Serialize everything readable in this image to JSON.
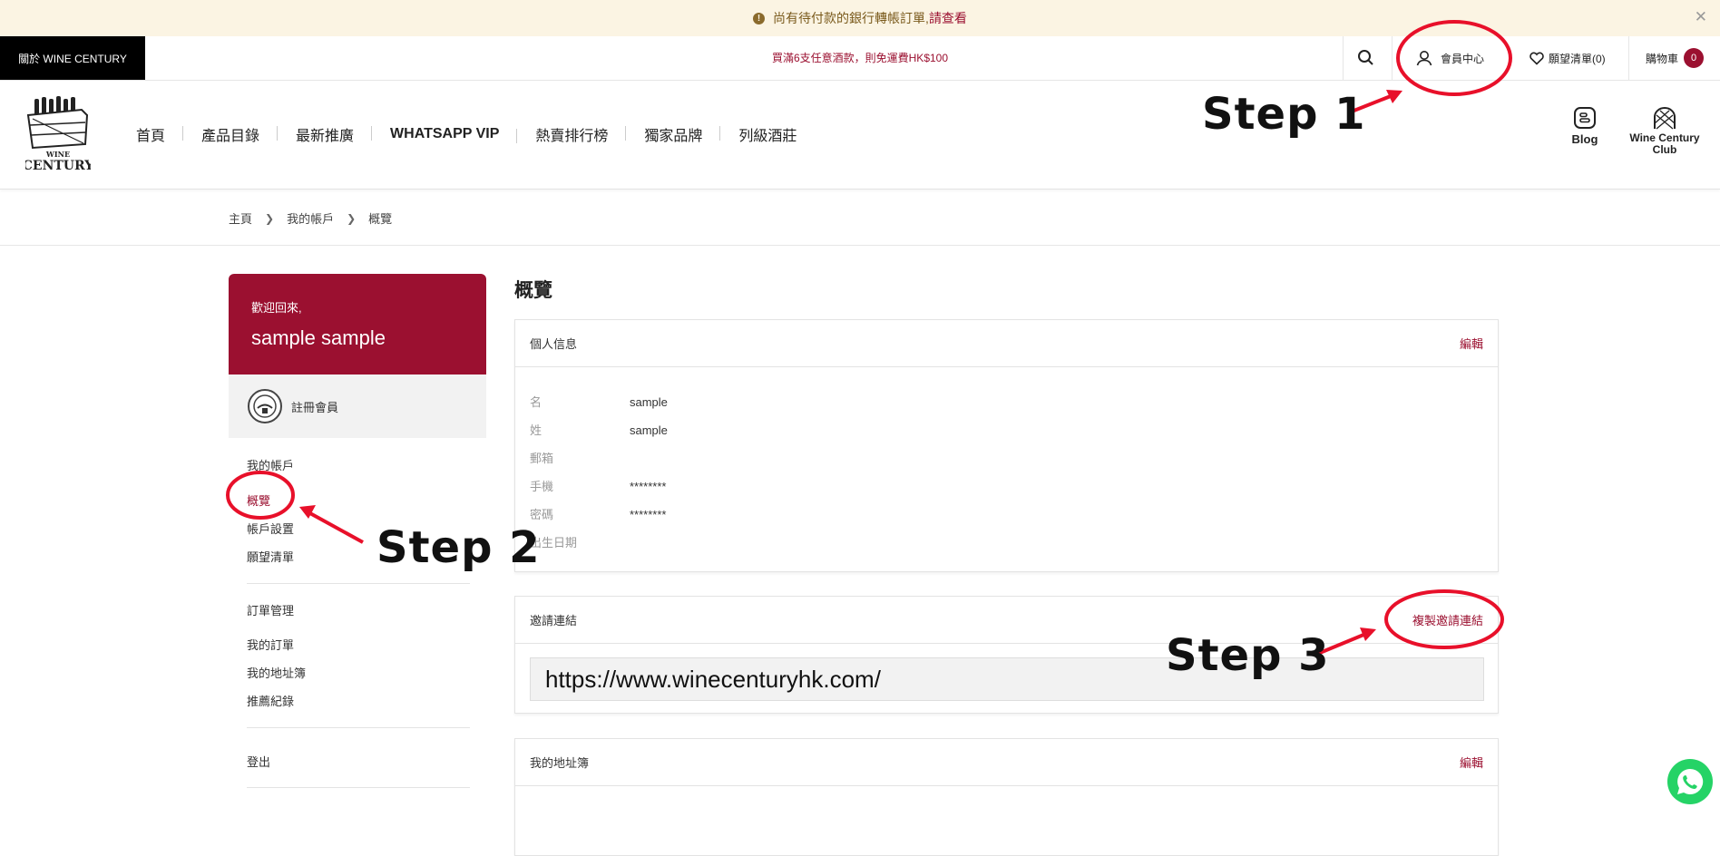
{
  "alert": {
    "text": "尚有待付款的銀行轉帳訂單, ",
    "link": "請查看"
  },
  "topbar": {
    "about": "關於 WINE CENTURY",
    "promo": "買滿6支任意酒款，則免運費HK$100",
    "member_center": "會員中心",
    "wishlist": "願望清單(0)",
    "cart": "購物車",
    "cart_count": "0"
  },
  "header": {
    "logo_text_top": "WINE",
    "logo_text_bottom": "CENTURY",
    "nav": [
      "首頁",
      "產品目錄",
      "最新推廣",
      "WHATSAPP VIP",
      "熱賣排行榜",
      "獨家品牌",
      "列級酒莊"
    ],
    "blog": "Blog",
    "club": "Wine Century Club"
  },
  "breadcrumb": [
    "主頁",
    "我的帳戶",
    "概覽"
  ],
  "sidebar": {
    "welcome": "歡迎回來,",
    "username": "sample sample",
    "tier": "註冊會員",
    "account_heading": "我的帳戶",
    "account_items": [
      "概覽",
      "帳戶設置",
      "願望清單"
    ],
    "orders_heading": "訂單管理",
    "order_items": [
      "我的訂單",
      "我的地址簿",
      "推薦紀錄"
    ],
    "logout": "登出"
  },
  "main": {
    "title": "概覽",
    "personal": {
      "heading": "個人信息",
      "edit": "編輯",
      "rows": [
        {
          "label": "名",
          "value": "sample"
        },
        {
          "label": "姓",
          "value": "sample"
        },
        {
          "label": "郵箱",
          "value": ""
        },
        {
          "label": "手機",
          "value": "********"
        },
        {
          "label": "密碼",
          "value": "********"
        },
        {
          "label": "出生日期",
          "value": ""
        }
      ]
    },
    "invite": {
      "heading": "邀請連結",
      "copy": "複製邀請連結",
      "url": "https://www.winecenturyhk.com/"
    },
    "address": {
      "heading": "我的地址簿",
      "edit": "編輯"
    }
  },
  "annotations": {
    "step1": "Step 1",
    "step2": "Step 2",
    "step3": "Step 3",
    "color": "#e8102a"
  },
  "colors": {
    "brand": "#9b1030",
    "alert_bg": "#fbf4e3"
  }
}
